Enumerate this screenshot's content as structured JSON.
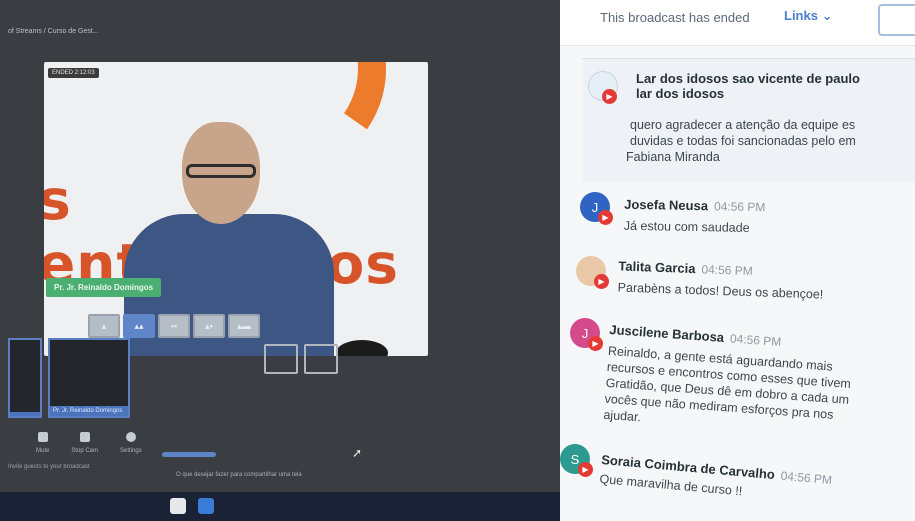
{
  "breadcrumb": "of Streams / Curso de Gest...",
  "stage": {
    "timer": "ENDED 2:12:03",
    "brand_text": "entrelamos",
    "brand_prefix": "s",
    "name_tag": "Pr. Jr. Reinaldo Domingos"
  },
  "thumbnails": [
    {
      "label": ""
    },
    {
      "label": "Pr. Jr. Reinaldo Domingos"
    }
  ],
  "controls": [
    {
      "label": "Mute",
      "icon": "mic-icon"
    },
    {
      "label": "Stop Cam",
      "icon": "camera-icon"
    },
    {
      "label": "Settings",
      "icon": "gear-icon"
    }
  ],
  "bottom_message": "Invite guests to your broadcast",
  "share_message": "O que desejar fazer para compartilhar uma tela",
  "chat": {
    "status": "This broadcast has ended",
    "links_label": "Links",
    "pinned": {
      "author_line1": "Lar dos idosos sao vicente de paulo",
      "author_line2": "lar dos idosos",
      "lines": [
        "quero agradecer a atenção da equipe es",
        "duvidas e todas foi sancionadas pelo em",
        "Fabiana Miranda"
      ]
    },
    "messages": [
      {
        "author": "Josefa Neusa",
        "time": "04:56 PM",
        "lines": [
          "Já estou com saudade"
        ],
        "avatar_letter": "J",
        "color": "#2f63c4"
      },
      {
        "author": "Talita Garcia",
        "time": "04:56 PM",
        "lines": [
          "Parabèns a todos! Deus os abençoe!"
        ],
        "avatar_letter": "",
        "color": "#e9c8a8"
      },
      {
        "author": "Juscilene Barbosa",
        "time": "04:56 PM",
        "lines": [
          "Reinaldo, a gente está aguardando mais",
          "recursos e encontros como esses que tivem",
          "Gratidão, que Deus dê em dobro a cada um",
          "vocês que não mediram esforços pra nos",
          "ajudar."
        ],
        "avatar_letter": "J",
        "color": "#d44a8a"
      },
      {
        "author": "Soraia Coimbra de Carvalho",
        "time": "04:56 PM",
        "lines": [
          "Que maravilha de curso !!"
        ],
        "avatar_letter": "S",
        "color": "#2c9a8e"
      }
    ]
  }
}
